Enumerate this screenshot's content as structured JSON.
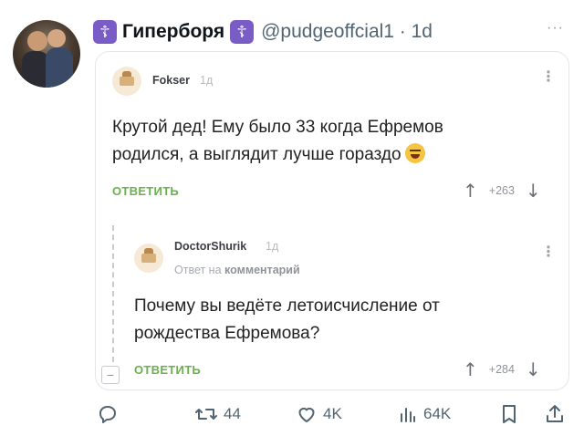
{
  "tweet": {
    "display_name": "Гиперборя",
    "badge_glyph": "☦",
    "handle": "@pudgeoffcial1 · 1d",
    "more_glyph": "···"
  },
  "card": {
    "comment1": {
      "user": "Fokser",
      "time": "1д",
      "text": "Крутой дед! Ему было 33 когда Ефремов родился, а выглядит лучше гораздо",
      "reply_label": "ОТВЕТИТЬ",
      "votes": "+263"
    },
    "comment2": {
      "user": "DoctorShurik",
      "time": "1д",
      "sub_prefix": "Ответ на",
      "sub_bold": "комментарий",
      "text": "Почему вы ведёте летоисчисление от рождества Ефремова?",
      "reply_label": "ОТВЕТИТЬ",
      "votes": "+284",
      "collapse_glyph": "−"
    },
    "up_glyph": "↑",
    "down_glyph": "↓",
    "kebab_glyph": "⋮"
  },
  "actions": {
    "retweets": "44",
    "likes": "4K",
    "views": "64K"
  },
  "colors": {
    "reply_green": "#6ab04c",
    "badge_purple": "#7a5cc7",
    "muted": "#536471"
  }
}
